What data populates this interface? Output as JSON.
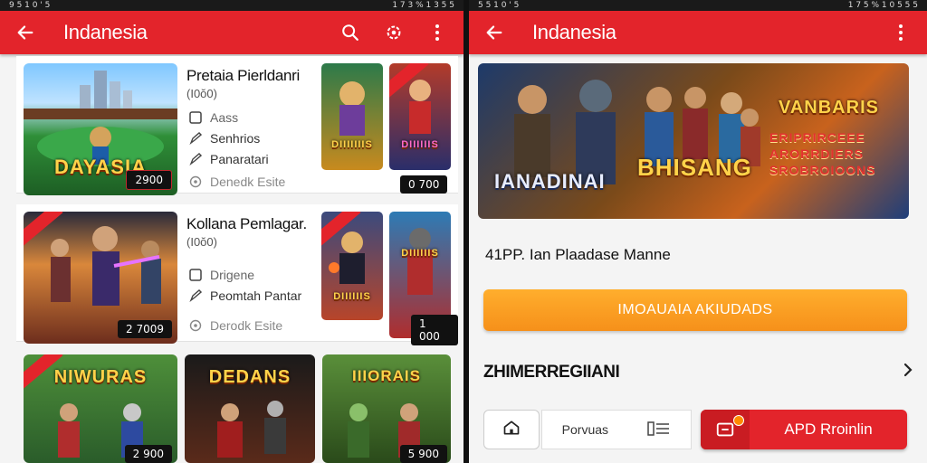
{
  "left": {
    "status": {
      "left": "9 5 1 0 ' 5",
      "right": "1 7 3 % 1 3 5 5"
    },
    "title": "Indanesia",
    "cards": [
      {
        "name": "Pretaia Pierldanri",
        "sub": "(I0ŏ0)",
        "poster": "DAYASIA",
        "price": "2900",
        "meta": [
          "Aass",
          "Senhrios",
          "Panaratari",
          "Denedk Esite"
        ],
        "side_price": "0 700",
        "side1": "DIIIIIIIS",
        "side2": "DIIIIIIS"
      },
      {
        "name": "Kollana Pemlagar.",
        "sub": "(I0ŏ0)",
        "poster": "",
        "price": "2 7009",
        "meta": [
          "Drigene",
          "Peomtah Pantar",
          "Derodk Esite"
        ],
        "side_price": "1 000",
        "side1": "DIIIIIIS",
        "side2": "DIIIIIIS"
      }
    ],
    "row3": [
      "NIWURAS",
      "DEDANS",
      "IIIORAIS"
    ],
    "row3_prices": [
      "2 900",
      "5 900"
    ]
  },
  "right": {
    "status": {
      "left": "5 5 1 0 ' 5",
      "right": "1 7 5 % 1 0 5 5 5"
    },
    "title": "Indanesia",
    "hero": {
      "t1": "IANADINAI",
      "t2": "BHISANG",
      "t3": "VANBARIS",
      "t4": "ERIPRIRCEEE",
      "t5": "ARORRDIERS",
      "t6": "SROBROIOONS"
    },
    "description": "41PP. Ian Plaadase Manne",
    "cta": "IMOAUAIA AKIUDADS",
    "section": "ZHIMERREGIIANI",
    "bottom": {
      "tab_label": "Porvuas",
      "red_label": "APD Rroinlin"
    }
  },
  "colors": {
    "brand_red": "#e3242b",
    "cta_orange": "#f6901a"
  }
}
